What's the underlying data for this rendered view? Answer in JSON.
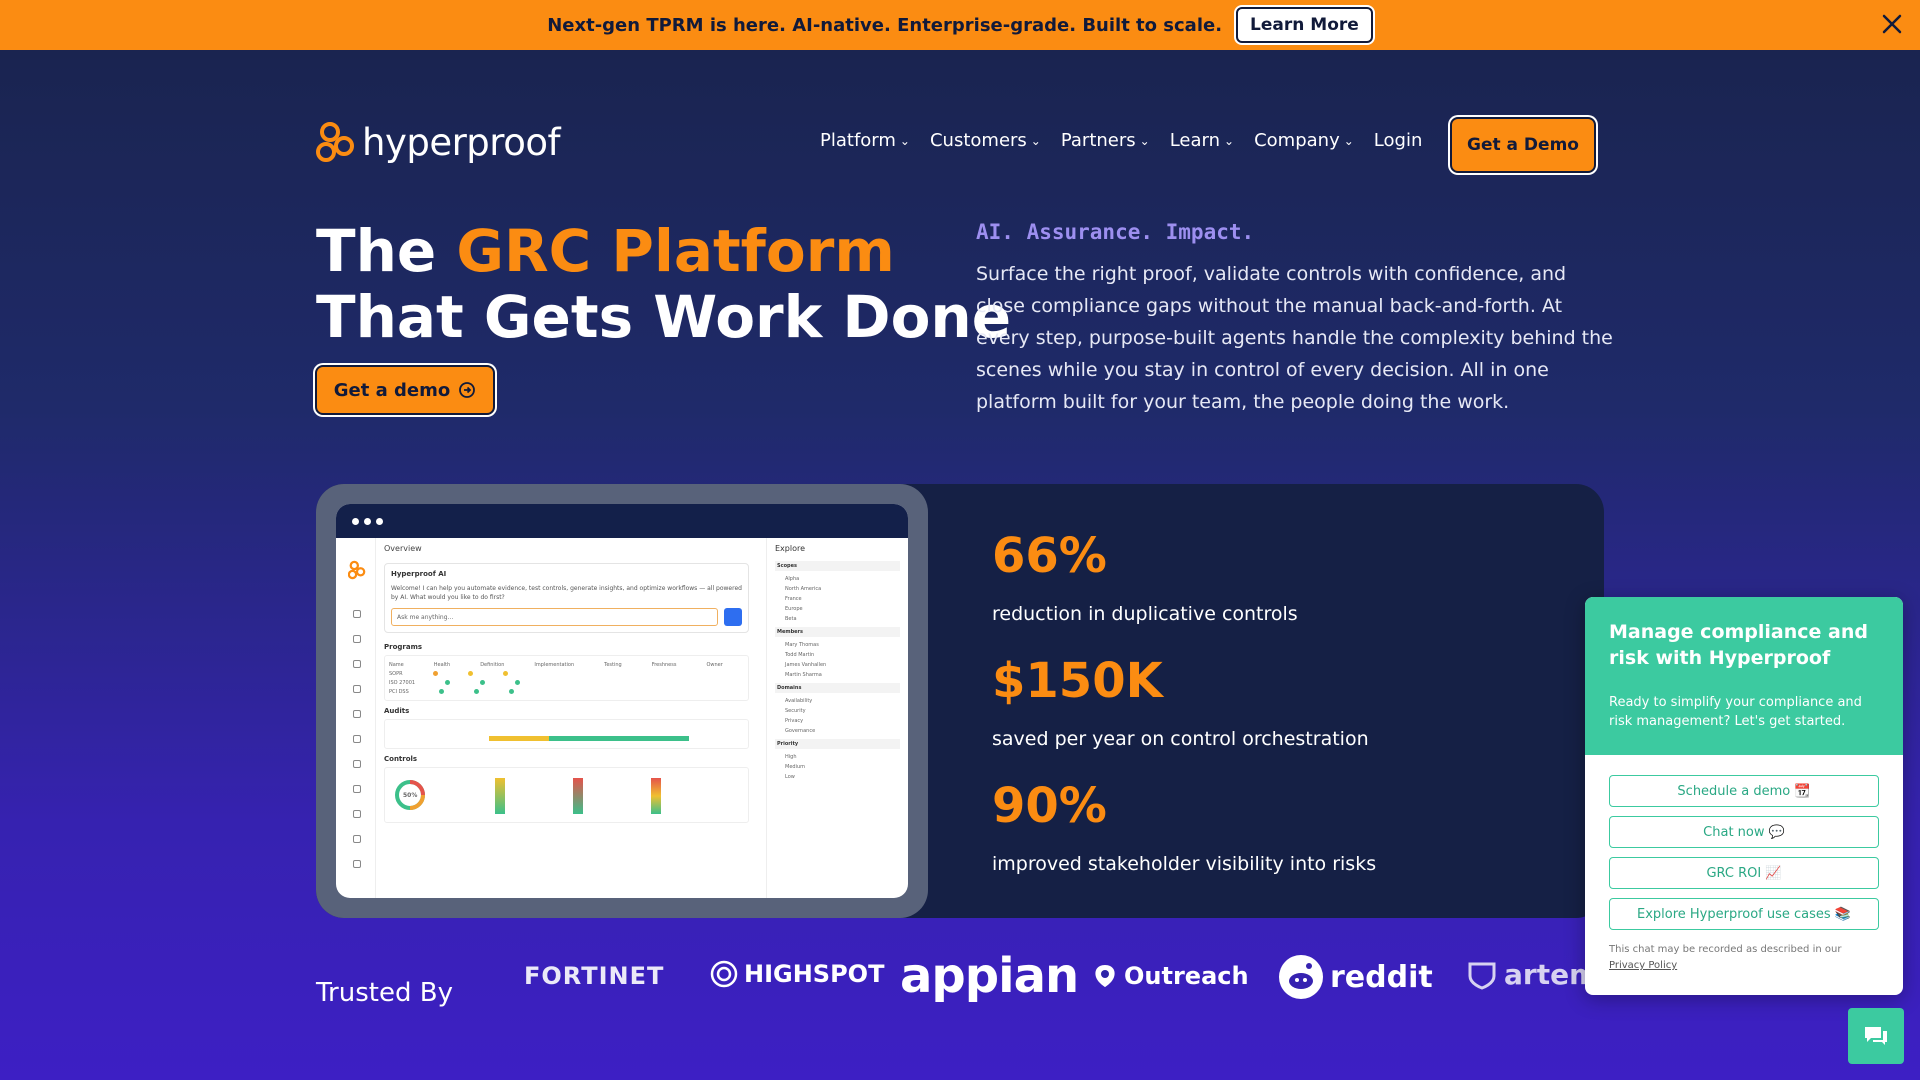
{
  "announcement": {
    "text": "Next-gen TPRM is here. AI-native. Enterprise-grade. Built to scale.",
    "button": "Learn More",
    "close_icon": "close-icon"
  },
  "header": {
    "logo_text": "hyperproof",
    "nav": [
      "Platform",
      "Customers",
      "Partners",
      "Learn",
      "Company"
    ],
    "login": "Login",
    "demo": "Get a Demo"
  },
  "hero": {
    "title_prefix": "The",
    "title_accent": "GRC Platform",
    "title_line2": "That Gets Work Done",
    "cta": "Get a demo",
    "tagline": "AI. Assurance. Impact.",
    "description": "Surface the right proof, validate controls with confidence, and close compliance gaps without the manual back-and-forth. At every step, purpose-built agents handle the complexity behind the scenes while you stay in control of every decision. All in one platform built for your team, the people doing the work."
  },
  "mockup": {
    "overview": "Overview",
    "ai_title": "Hyperproof AI",
    "ai_message": "Welcome! I can help you automate evidence, test controls, generate insights, and optimize workflows — all powered by AI. What would you like to do first?",
    "ai_placeholder": "Ask me anything...",
    "programs": "Programs",
    "audits": "Audits",
    "controls": "Controls",
    "programs_cols": [
      "Name",
      "Health",
      "Definition",
      "Implementation",
      "Testing",
      "Freshness",
      "Owner"
    ],
    "programs_rows": [
      "SOPR",
      "ISO 27001",
      "PCI DSS"
    ],
    "explore": "Explore",
    "explore_sections": [
      {
        "name": "Scopes",
        "items": [
          "Alpha",
          "North America",
          "France",
          "Europe",
          "Beta"
        ]
      },
      {
        "name": "Members",
        "items": [
          "Mary Thomas",
          "Todd Martin",
          "James Vanhallen",
          "Martin Sharma"
        ]
      },
      {
        "name": "Domains",
        "items": [
          "Availability",
          "Security",
          "Privacy",
          "Governance"
        ]
      },
      {
        "name": "Priority",
        "items": [
          "High",
          "Medium",
          "Low"
        ]
      }
    ],
    "health_pct": "50%"
  },
  "stats": [
    {
      "value": "66%",
      "label": "reduction in duplicative controls"
    },
    {
      "value": "$150K",
      "label": "saved per year on control orchestration"
    },
    {
      "value": "90%",
      "label": "improved stakeholder visibility into risks"
    }
  ],
  "trusted": {
    "label": "Trusted By",
    "brands": [
      "FORTINET",
      "HIGHSPOT",
      "appian",
      "Outreach",
      "reddit",
      "artem"
    ]
  },
  "chat": {
    "title": "Manage compliance and risk with Hyperproof",
    "subtitle": "Ready to simplify your compliance and risk management? Let's get started.",
    "buttons": [
      "Schedule a demo 📆",
      "Chat now 💬",
      "GRC ROI 📈",
      "Explore Hyperproof use cases 📚"
    ],
    "note": "This chat may be recorded as described in our",
    "privacy": "Privacy Policy"
  },
  "colors": {
    "accent": "#fb8c12",
    "teal": "#3ccaa0",
    "tagline": "#9d8ff0"
  }
}
